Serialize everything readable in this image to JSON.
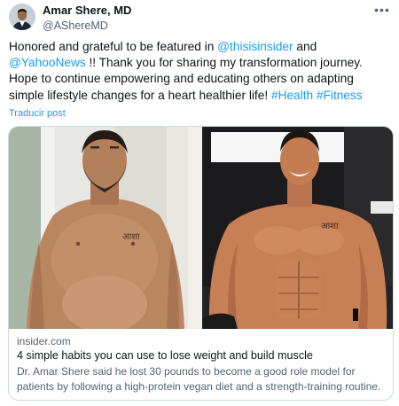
{
  "author": {
    "display_name": "Amar Shere, MD",
    "handle": "@AShereMD",
    "avatar_icon": "profile-photo"
  },
  "more_icon": "more-horizontal-icon",
  "tweet": {
    "text_1": "Honored and grateful to be featured in ",
    "mention_1": "@thisisinsider",
    "text_2": " and ",
    "mention_2": "@YahooNews",
    "text_3": " !! Thank you for sharing my transformation journey. Hope to continue empowering and educating others on adapting simple lifestyle changes for a heart healthier life! ",
    "hashtag_1": "#Health",
    "text_4": " ",
    "hashtag_2": "#Fitness"
  },
  "translate_label": "Traducir post",
  "card": {
    "before_tattoo": "आशा",
    "after_tattoo": "आशा",
    "domain": "insider.com",
    "title": "4 simple habits you can use to lose weight and build muscle",
    "description": "Dr. Amar Shere said he lost 30 pounds to become a good role model for patients by following a high-protein vegan diet and a strength-training routine."
  },
  "colors": {
    "link": "#1d9bf0",
    "text": "#0f1419",
    "secondary": "#536471",
    "border": "#cfd9de"
  }
}
